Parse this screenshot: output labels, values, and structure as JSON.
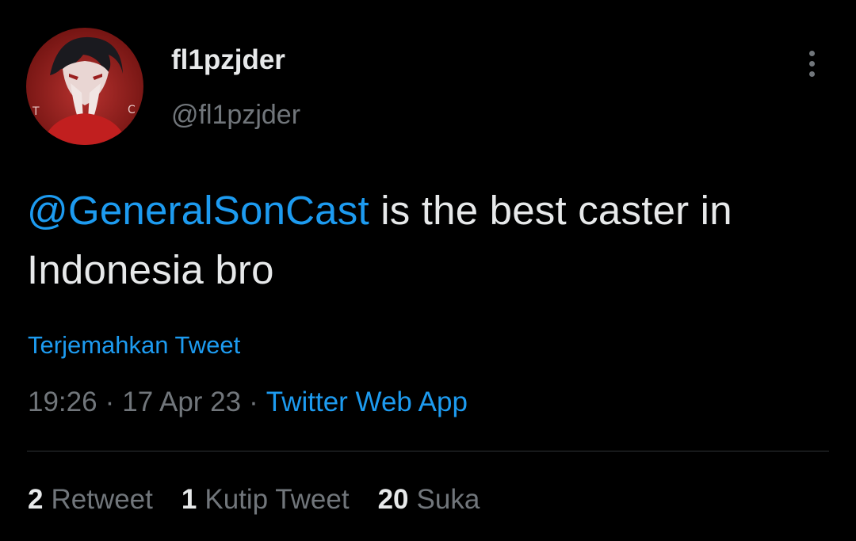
{
  "user": {
    "display_name": "fl1pzjder",
    "handle": "@fl1pzjder"
  },
  "tweet": {
    "mention": "@GeneralSonCast",
    "text_after_mention": " is the best caster in Indonesia bro"
  },
  "translate_label": "Terjemahkan Tweet",
  "meta": {
    "time": "19:26",
    "separator": "·",
    "date": "17 Apr 23",
    "source": "Twitter Web App"
  },
  "stats": [
    {
      "count": "2",
      "label": "Retweet"
    },
    {
      "count": "1",
      "label": "Kutip Tweet"
    },
    {
      "count": "20",
      "label": "Suka"
    }
  ],
  "icons": {
    "more": "more-vertical-icon"
  },
  "colors": {
    "background": "#000000",
    "text_primary": "#e7e9ea",
    "text_secondary": "#71767b",
    "accent": "#1d9bf0",
    "divider": "#2f3336"
  }
}
